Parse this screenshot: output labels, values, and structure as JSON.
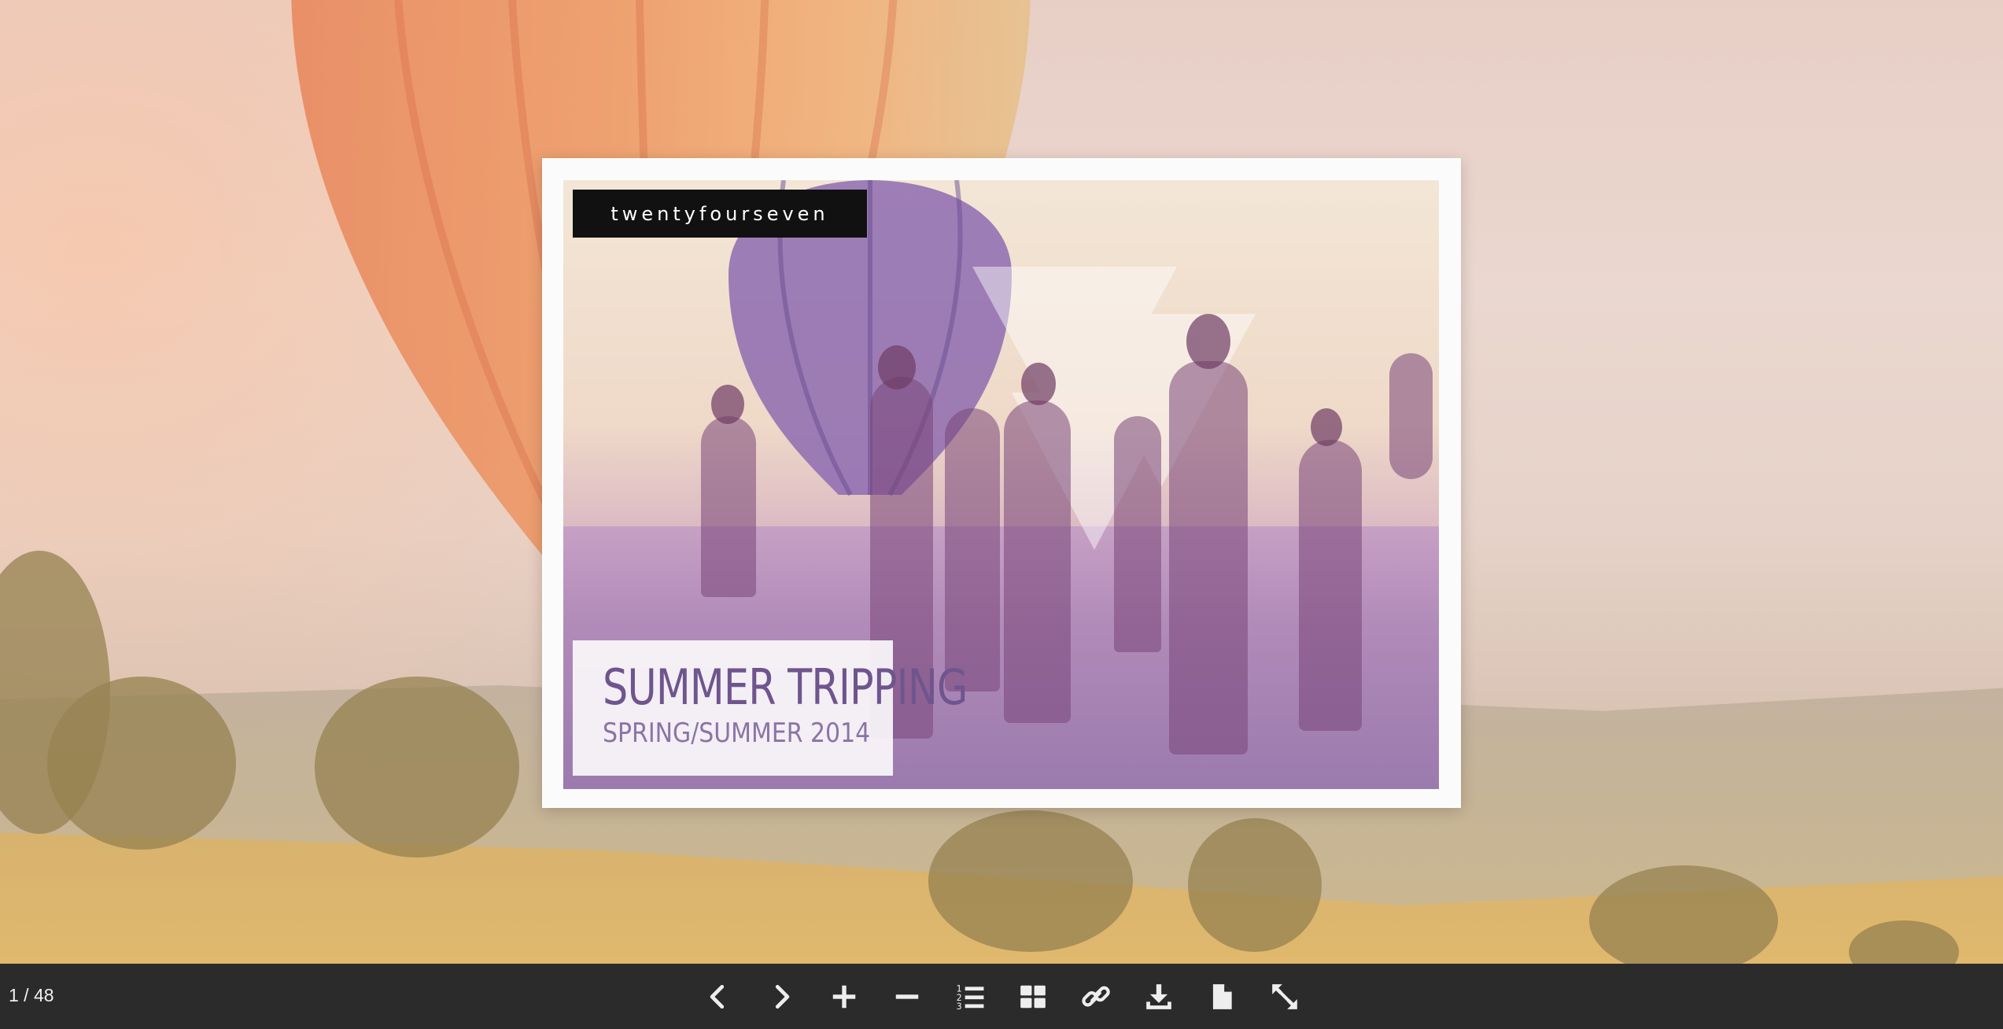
{
  "viewer": {
    "page_counter": "1 / 48"
  },
  "cover": {
    "brand": "twentyfourseven",
    "title": "SUMMER TRIPPING",
    "subtitle": "SPRING/SUMMER 2014"
  },
  "toolbar": {
    "buttons": [
      {
        "icon": "chevron-left-icon",
        "action": "previous-page"
      },
      {
        "icon": "chevron-right-icon",
        "action": "next-page"
      },
      {
        "icon": "plus-icon",
        "action": "zoom-in"
      },
      {
        "icon": "minus-icon",
        "action": "zoom-out"
      },
      {
        "icon": "numbered-list-icon",
        "action": "table-of-contents"
      },
      {
        "icon": "grid-icon",
        "action": "thumbnails"
      },
      {
        "icon": "link-icon",
        "action": "share-link"
      },
      {
        "icon": "download-icon",
        "action": "download"
      },
      {
        "icon": "document-icon",
        "action": "single-page"
      },
      {
        "icon": "fullscreen-icon",
        "action": "fullscreen"
      }
    ]
  },
  "colors": {
    "toolbar_bg": "#2b2b2b",
    "icon": "#eeeeee",
    "title_purple": "#6f558e"
  }
}
